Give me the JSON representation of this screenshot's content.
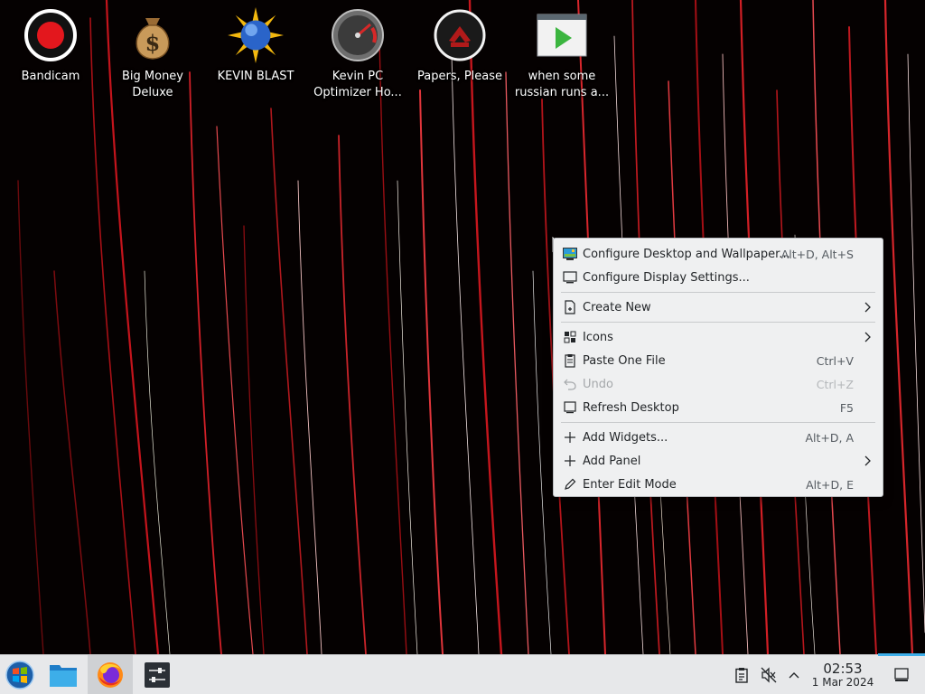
{
  "desktop_icons": [
    {
      "label": "Bandicam",
      "icon": "bandicam-record-icon"
    },
    {
      "label": "Big Money\nDeluxe",
      "icon": "money-bag-icon"
    },
    {
      "label": "KEVIN BLAST",
      "icon": "sun-globe-icon"
    },
    {
      "label": "Kevin PC\nOptimizer Ho...",
      "icon": "speedometer-icon"
    },
    {
      "label": "Papers, Please",
      "icon": "papers-please-emblem-icon"
    },
    {
      "label": "when some\nrussian runs a...",
      "icon": "video-play-icon"
    }
  ],
  "context_menu": {
    "items": [
      {
        "label": "Configure Desktop and Wallpaper...",
        "shortcut": "Alt+D, Alt+S",
        "icon": "wallpaper-icon"
      },
      {
        "label": "Configure Display Settings...",
        "shortcut": "",
        "icon": "display-icon"
      },
      {
        "label": "Create New",
        "shortcut": "",
        "icon": "new-document-icon",
        "submenu": true
      },
      {
        "label": "Icons",
        "shortcut": "",
        "icon": "grid-icon",
        "submenu": true
      },
      {
        "label": "Paste One File",
        "shortcut": "Ctrl+V",
        "icon": "clipboard-icon"
      },
      {
        "label": "Undo",
        "shortcut": "Ctrl+Z",
        "icon": "undo-icon",
        "disabled": true
      },
      {
        "label": "Refresh Desktop",
        "shortcut": "F5",
        "icon": "refresh-icon"
      },
      {
        "label": "Add Widgets...",
        "shortcut": "Alt+D, A",
        "icon": "plus-icon"
      },
      {
        "label": "Add Panel",
        "shortcut": "",
        "icon": "plus-icon",
        "submenu": true
      },
      {
        "label": "Enter Edit Mode",
        "shortcut": "Alt+D, E",
        "icon": "pencil-icon"
      }
    ]
  },
  "taskbar": {
    "launcher": "start-menu-orb-icon",
    "apps": [
      "file-manager-icon",
      "firefox-icon",
      "mixer-settings-icon"
    ],
    "tray": [
      "clipboard-icon",
      "volume-muted-icon",
      "chevron-up-icon"
    ],
    "clock": {
      "time": "02:53",
      "date": "1 Mar 2024"
    }
  },
  "colors": {
    "menu_bg": "#eff0f1",
    "taskbar_bg": "#e7e8ea",
    "accent": "#3daee9",
    "wallpaper_red": "#d6262b"
  }
}
